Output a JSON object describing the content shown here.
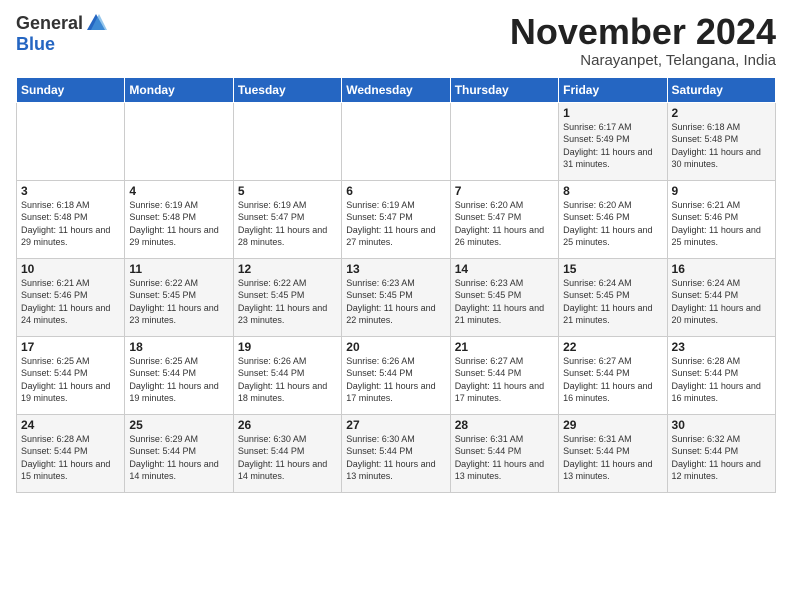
{
  "logo": {
    "general": "General",
    "blue": "Blue"
  },
  "title": "November 2024",
  "subtitle": "Narayanpet, Telangana, India",
  "days_of_week": [
    "Sunday",
    "Monday",
    "Tuesday",
    "Wednesday",
    "Thursday",
    "Friday",
    "Saturday"
  ],
  "weeks": [
    [
      {
        "day": "",
        "info": ""
      },
      {
        "day": "",
        "info": ""
      },
      {
        "day": "",
        "info": ""
      },
      {
        "day": "",
        "info": ""
      },
      {
        "day": "",
        "info": ""
      },
      {
        "day": "1",
        "info": "Sunrise: 6:17 AM\nSunset: 5:49 PM\nDaylight: 11 hours\nand 31 minutes."
      },
      {
        "day": "2",
        "info": "Sunrise: 6:18 AM\nSunset: 5:48 PM\nDaylight: 11 hours\nand 30 minutes."
      }
    ],
    [
      {
        "day": "3",
        "info": "Sunrise: 6:18 AM\nSunset: 5:48 PM\nDaylight: 11 hours\nand 29 minutes."
      },
      {
        "day": "4",
        "info": "Sunrise: 6:19 AM\nSunset: 5:48 PM\nDaylight: 11 hours\nand 29 minutes."
      },
      {
        "day": "5",
        "info": "Sunrise: 6:19 AM\nSunset: 5:47 PM\nDaylight: 11 hours\nand 28 minutes."
      },
      {
        "day": "6",
        "info": "Sunrise: 6:19 AM\nSunset: 5:47 PM\nDaylight: 11 hours\nand 27 minutes."
      },
      {
        "day": "7",
        "info": "Sunrise: 6:20 AM\nSunset: 5:47 PM\nDaylight: 11 hours\nand 26 minutes."
      },
      {
        "day": "8",
        "info": "Sunrise: 6:20 AM\nSunset: 5:46 PM\nDaylight: 11 hours\nand 25 minutes."
      },
      {
        "day": "9",
        "info": "Sunrise: 6:21 AM\nSunset: 5:46 PM\nDaylight: 11 hours\nand 25 minutes."
      }
    ],
    [
      {
        "day": "10",
        "info": "Sunrise: 6:21 AM\nSunset: 5:46 PM\nDaylight: 11 hours\nand 24 minutes."
      },
      {
        "day": "11",
        "info": "Sunrise: 6:22 AM\nSunset: 5:45 PM\nDaylight: 11 hours\nand 23 minutes."
      },
      {
        "day": "12",
        "info": "Sunrise: 6:22 AM\nSunset: 5:45 PM\nDaylight: 11 hours\nand 23 minutes."
      },
      {
        "day": "13",
        "info": "Sunrise: 6:23 AM\nSunset: 5:45 PM\nDaylight: 11 hours\nand 22 minutes."
      },
      {
        "day": "14",
        "info": "Sunrise: 6:23 AM\nSunset: 5:45 PM\nDaylight: 11 hours\nand 21 minutes."
      },
      {
        "day": "15",
        "info": "Sunrise: 6:24 AM\nSunset: 5:45 PM\nDaylight: 11 hours\nand 21 minutes."
      },
      {
        "day": "16",
        "info": "Sunrise: 6:24 AM\nSunset: 5:44 PM\nDaylight: 11 hours\nand 20 minutes."
      }
    ],
    [
      {
        "day": "17",
        "info": "Sunrise: 6:25 AM\nSunset: 5:44 PM\nDaylight: 11 hours\nand 19 minutes."
      },
      {
        "day": "18",
        "info": "Sunrise: 6:25 AM\nSunset: 5:44 PM\nDaylight: 11 hours\nand 19 minutes."
      },
      {
        "day": "19",
        "info": "Sunrise: 6:26 AM\nSunset: 5:44 PM\nDaylight: 11 hours\nand 18 minutes."
      },
      {
        "day": "20",
        "info": "Sunrise: 6:26 AM\nSunset: 5:44 PM\nDaylight: 11 hours\nand 17 minutes."
      },
      {
        "day": "21",
        "info": "Sunrise: 6:27 AM\nSunset: 5:44 PM\nDaylight: 11 hours\nand 17 minutes."
      },
      {
        "day": "22",
        "info": "Sunrise: 6:27 AM\nSunset: 5:44 PM\nDaylight: 11 hours\nand 16 minutes."
      },
      {
        "day": "23",
        "info": "Sunrise: 6:28 AM\nSunset: 5:44 PM\nDaylight: 11 hours\nand 16 minutes."
      }
    ],
    [
      {
        "day": "24",
        "info": "Sunrise: 6:28 AM\nSunset: 5:44 PM\nDaylight: 11 hours\nand 15 minutes."
      },
      {
        "day": "25",
        "info": "Sunrise: 6:29 AM\nSunset: 5:44 PM\nDaylight: 11 hours\nand 14 minutes."
      },
      {
        "day": "26",
        "info": "Sunrise: 6:30 AM\nSunset: 5:44 PM\nDaylight: 11 hours\nand 14 minutes."
      },
      {
        "day": "27",
        "info": "Sunrise: 6:30 AM\nSunset: 5:44 PM\nDaylight: 11 hours\nand 13 minutes."
      },
      {
        "day": "28",
        "info": "Sunrise: 6:31 AM\nSunset: 5:44 PM\nDaylight: 11 hours\nand 13 minutes."
      },
      {
        "day": "29",
        "info": "Sunrise: 6:31 AM\nSunset: 5:44 PM\nDaylight: 11 hours\nand 13 minutes."
      },
      {
        "day": "30",
        "info": "Sunrise: 6:32 AM\nSunset: 5:44 PM\nDaylight: 11 hours\nand 12 minutes."
      }
    ]
  ]
}
